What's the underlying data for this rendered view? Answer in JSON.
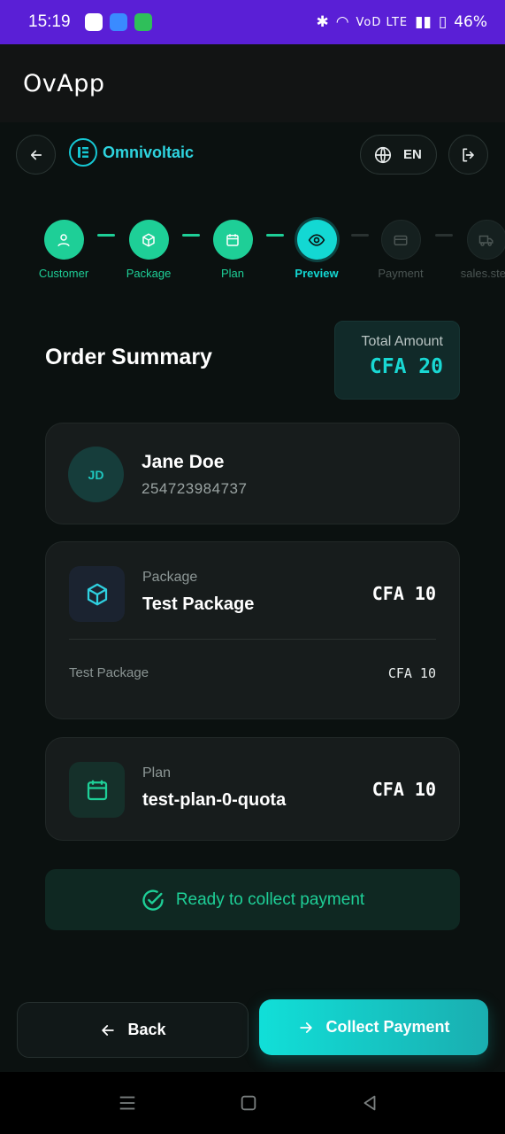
{
  "status_bar": {
    "time": "15:19",
    "network": "VoD LTE",
    "battery": "46%"
  },
  "app_bar": {
    "title": "OvApp"
  },
  "header": {
    "brand": "Omnivoltaic",
    "language": "EN"
  },
  "stepper": {
    "steps": [
      {
        "label": "Customer",
        "state": "done"
      },
      {
        "label": "Package",
        "state": "done"
      },
      {
        "label": "Plan",
        "state": "done"
      },
      {
        "label": "Preview",
        "state": "active"
      },
      {
        "label": "Payment",
        "state": "todo"
      },
      {
        "label": "sales.step",
        "state": "todo"
      }
    ]
  },
  "summary": {
    "title": "Order Summary",
    "total_label": "Total Amount",
    "total_value": "CFA 20"
  },
  "customer": {
    "initials": "JD",
    "name": "Jane Doe",
    "phone": "254723984737"
  },
  "package": {
    "kicker": "Package",
    "name": "Test Package",
    "price": "CFA 10",
    "line_items": [
      {
        "name": "Test Package",
        "price": "CFA 10"
      }
    ]
  },
  "plan": {
    "kicker": "Plan",
    "name": "test-plan-0-quota",
    "price": "CFA 10"
  },
  "status": {
    "message": "Ready to collect payment"
  },
  "actions": {
    "back_label": "Back",
    "collect_label": "Collect Payment"
  },
  "colors": {
    "accent": "#13d8d3",
    "success": "#1ecf97",
    "status_bar": "#5a1fd6"
  }
}
